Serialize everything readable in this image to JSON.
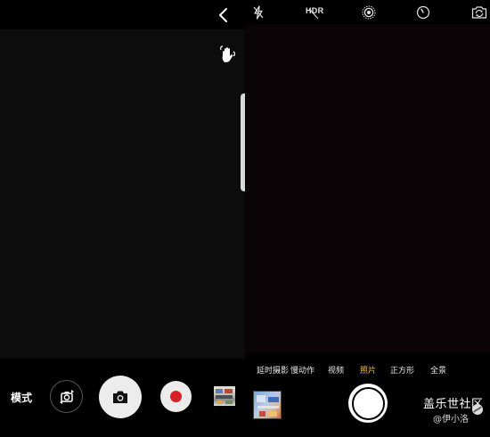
{
  "left_camera": {
    "mode_label": "模式",
    "icons": {
      "back": "chevron-left-icon",
      "gesture": "hand-gesture-icon",
      "switch_camera": "switch-camera-icon",
      "photo": "camera-icon",
      "record": "record-icon"
    },
    "colors": {
      "record_dot": "#d8202a"
    }
  },
  "right_camera": {
    "top_bar": {
      "hdr_label": "HDR",
      "icons": [
        "flash-off-icon",
        "hdr-icon",
        "live-photo-icon",
        "timer-icon",
        "flip-camera-icon"
      ]
    },
    "modes": [
      {
        "label": "延时摄影",
        "active": false
      },
      {
        "label": "慢动作",
        "active": false
      },
      {
        "label": "视频",
        "active": false
      },
      {
        "label": "照片",
        "active": true
      },
      {
        "label": "正方形",
        "active": false
      },
      {
        "label": "全景",
        "active": false
      }
    ],
    "colors": {
      "active_mode": "#f4c237"
    }
  },
  "watermark": {
    "title": "盖乐世社区",
    "author": "@伊小洛"
  }
}
